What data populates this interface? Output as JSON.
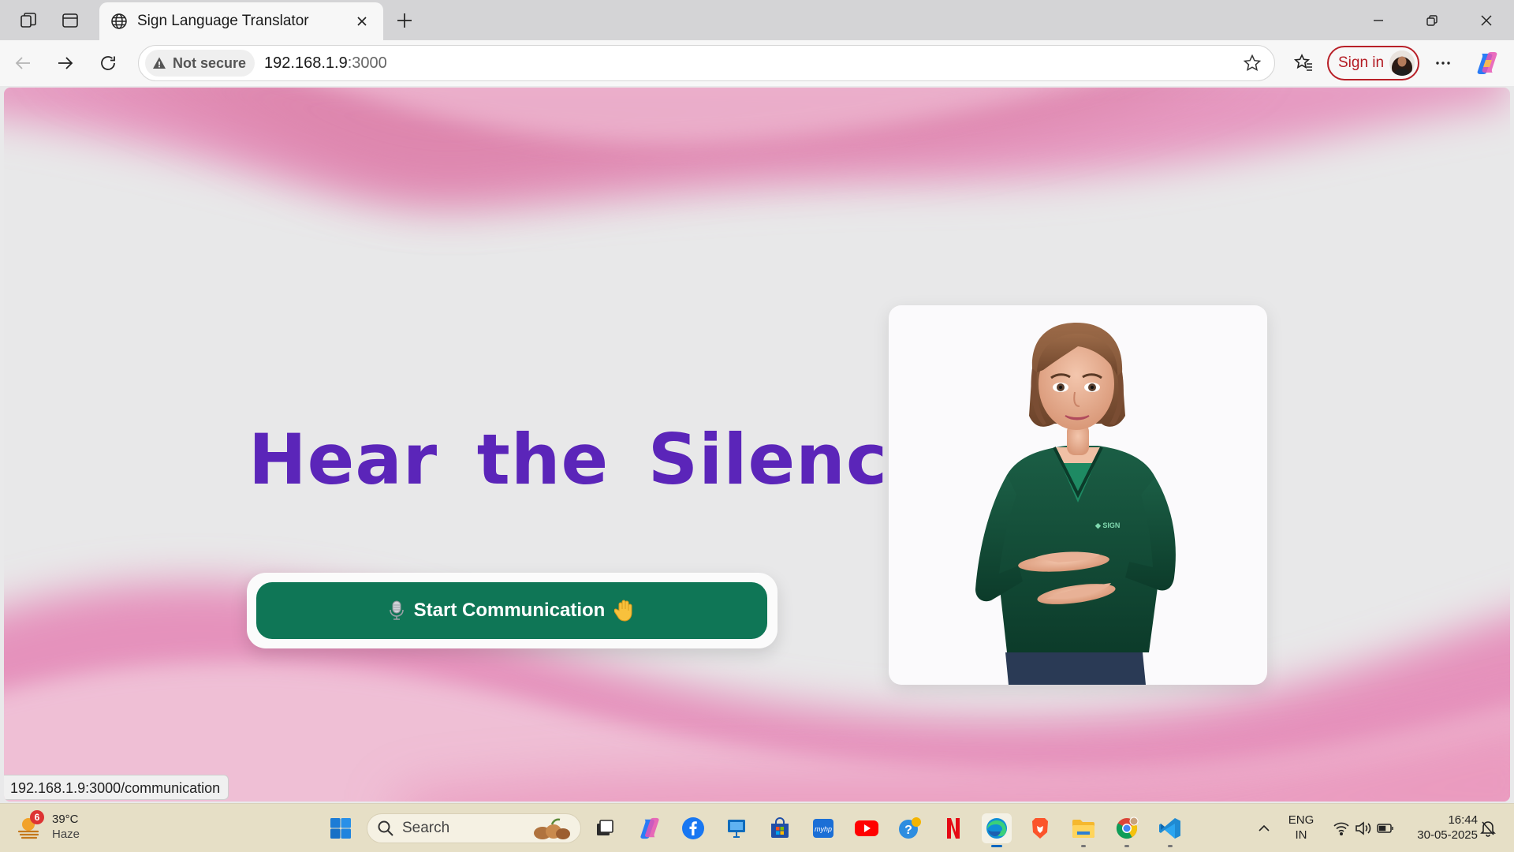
{
  "browser": {
    "tab": {
      "title": "Sign Language Translator"
    },
    "address": {
      "security_label": "Not secure",
      "host": "192.168.1.9",
      "port": ":3000"
    },
    "sign_in_label": "Sign in",
    "status_url": "192.168.1.9:3000/communication"
  },
  "page": {
    "hero_title": "Hear the Silence",
    "cta_label": "Start Communication",
    "colors": {
      "title": "#5b25b9",
      "cta": "#0f7656",
      "wave": "#e28db8"
    }
  },
  "taskbar": {
    "weather": {
      "badge": "6",
      "temp": "39°C",
      "condition": "Haze"
    },
    "search_label": "Search",
    "tray": {
      "lang": "ENG",
      "region": "IN",
      "time": "16:44",
      "date": "30-05-2025"
    }
  }
}
